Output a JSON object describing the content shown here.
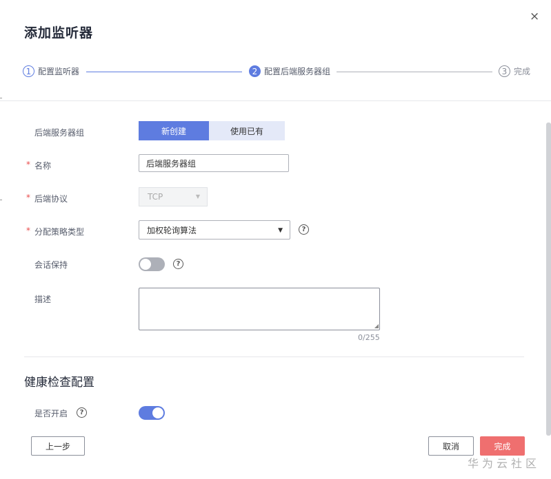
{
  "dialog": {
    "title": "添加监听器",
    "close_icon": "×"
  },
  "steps": [
    {
      "num": "1",
      "label": "配置监听器",
      "state": "done"
    },
    {
      "num": "2",
      "label": "配置后端服务器组",
      "state": "active"
    },
    {
      "num": "3",
      "label": "完成",
      "state": "pending"
    }
  ],
  "form": {
    "server_group": {
      "label": "后端服务器组",
      "options": [
        "新创建",
        "使用已有"
      ]
    },
    "name": {
      "label": "名称",
      "value": "后端服务器组"
    },
    "protocol": {
      "label": "后端协议",
      "value": "TCP"
    },
    "algorithm": {
      "label": "分配策略类型",
      "value": "加权轮询算法"
    },
    "session": {
      "label": "会话保持"
    },
    "description": {
      "label": "描述",
      "counter": "0/255"
    },
    "required_mark": "*"
  },
  "health": {
    "title": "健康检查配置",
    "enable_label": "是否开启"
  },
  "footer": {
    "prev": "上一步",
    "cancel": "取消",
    "finish": "完成"
  },
  "watermark": "华为云社区",
  "colors": {
    "primary": "#5e7ce0",
    "danger": "#ef6f6f"
  }
}
